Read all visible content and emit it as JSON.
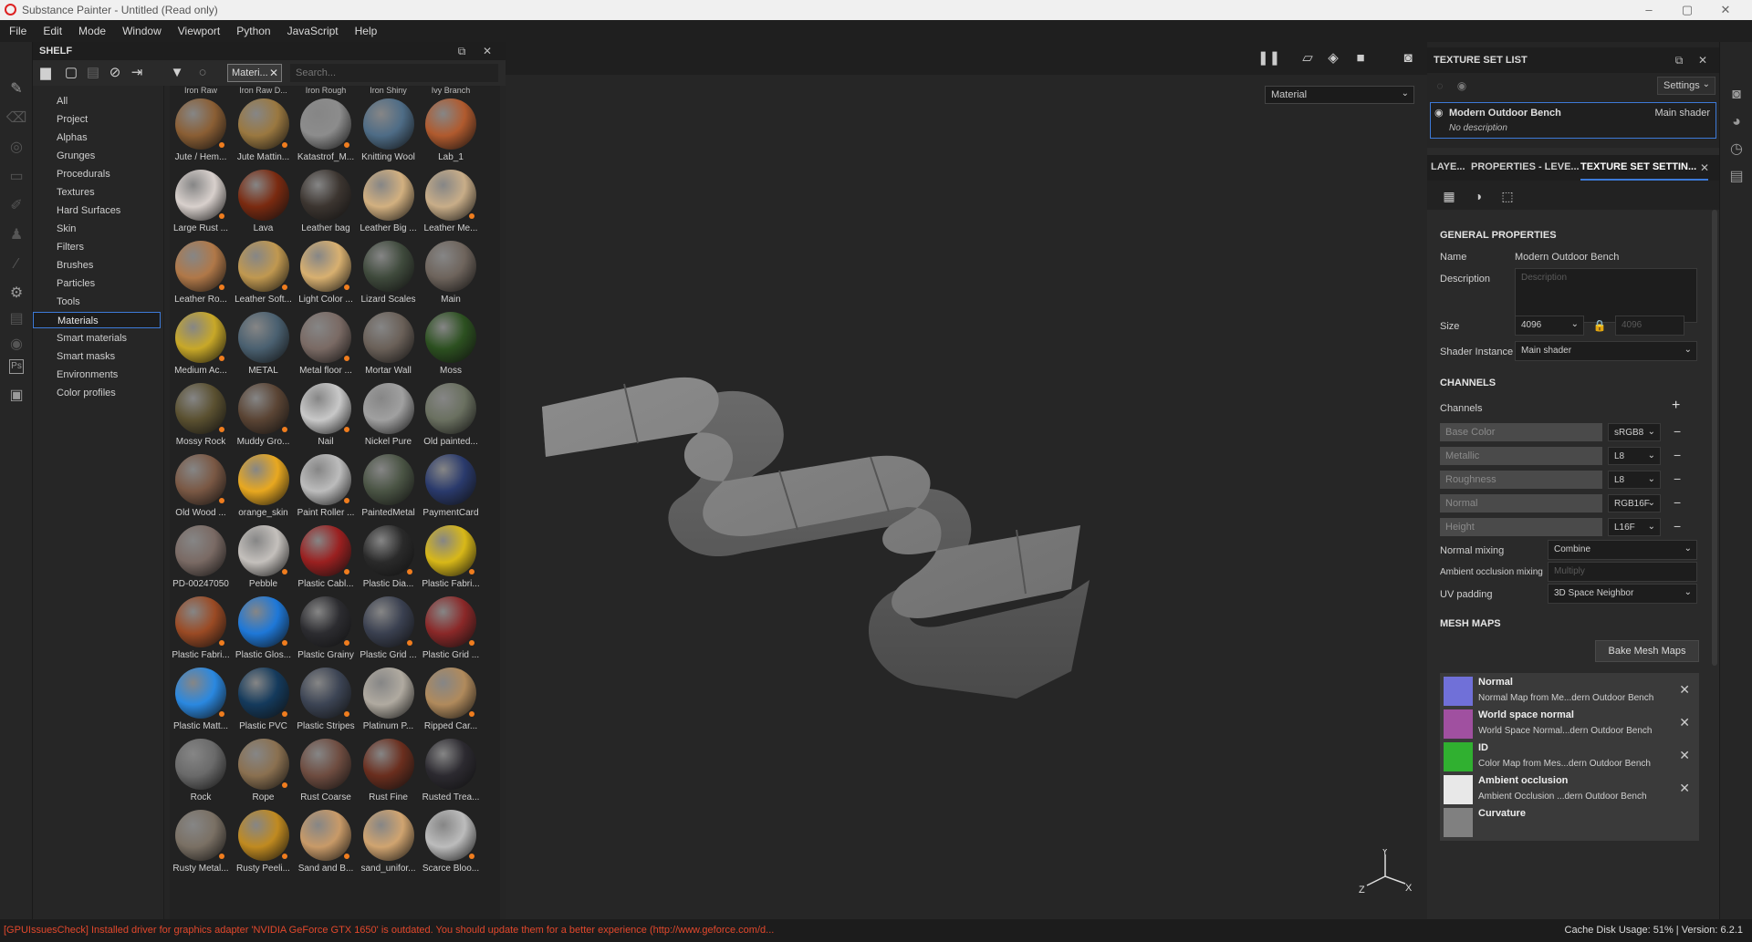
{
  "window": {
    "title": "Substance Painter - Untitled (Read only)",
    "controls": [
      "–",
      "▢",
      "✕"
    ]
  },
  "menu": [
    "File",
    "Edit",
    "Mode",
    "Window",
    "Viewport",
    "Python",
    "JavaScript",
    "Help"
  ],
  "shelf": {
    "title": "SHELF",
    "filter_chip": "Materi...",
    "search_placeholder": "Search...",
    "categories": [
      "All",
      "Project",
      "Alphas",
      "Grunges",
      "Procedurals",
      "Textures",
      "Hard Surfaces",
      "Skin",
      "Filters",
      "Brushes",
      "Particles",
      "Tools",
      "Materials",
      "Smart materials",
      "Smart masks",
      "Environments",
      "Color profiles"
    ],
    "selected_category": "Materials",
    "top_row_labels": [
      "Iron Raw",
      "Iron Raw D...",
      "Iron Rough",
      "Iron Shiny",
      "Ivy Branch"
    ],
    "materials": [
      {
        "name": "Jute / Hem...",
        "color": "#8a5e34",
        "new": true
      },
      {
        "name": "Jute Mattin...",
        "color": "#9a7840",
        "new": true
      },
      {
        "name": "Katastrof_M...",
        "color": "#8c8c8c",
        "new": true
      },
      {
        "name": "Knitting Wool",
        "color": "#4e6c86",
        "new": false
      },
      {
        "name": "Lab_1",
        "color": "#b05a2e",
        "new": false
      },
      {
        "name": "Large Rust ...",
        "color": "#d8d0cc",
        "new": true
      },
      {
        "name": "Lava",
        "color": "#7a2a10",
        "new": false
      },
      {
        "name": "Leather bag",
        "color": "#3c3530",
        "new": false
      },
      {
        "name": "Leather Big ...",
        "color": "#d2b080",
        "new": false
      },
      {
        "name": "Leather Me...",
        "color": "#c8ad88",
        "new": true
      },
      {
        "name": "Leather Ro...",
        "color": "#b07848",
        "new": true
      },
      {
        "name": "Leather Soft...",
        "color": "#c09850",
        "new": true
      },
      {
        "name": "Light Color ...",
        "color": "#d8b070",
        "new": true
      },
      {
        "name": "Lizard Scales",
        "color": "#3f4a3c",
        "new": false
      },
      {
        "name": "Main",
        "color": "#6e645c",
        "new": false
      },
      {
        "name": "Medium Ac...",
        "color": "#c8a828",
        "new": true
      },
      {
        "name": "METAL",
        "color": "#4a6070",
        "new": false
      },
      {
        "name": "Metal floor ...",
        "color": "#7a6a64",
        "new": true
      },
      {
        "name": "Mortar Wall",
        "color": "#6a6058",
        "new": false
      },
      {
        "name": "Moss",
        "color": "#2c5020",
        "new": false
      },
      {
        "name": "Mossy Rock",
        "color": "#5a5030",
        "new": true
      },
      {
        "name": "Muddy Gro...",
        "color": "#5a4434",
        "new": true
      },
      {
        "name": "Nail",
        "color": "#c8c8c8",
        "new": true
      },
      {
        "name": "Nickel Pure",
        "color": "#a0a0a0",
        "new": false
      },
      {
        "name": "Old painted...",
        "color": "#6a7060",
        "new": false
      },
      {
        "name": "Old Wood ...",
        "color": "#7a5844",
        "new": true
      },
      {
        "name": "orange_skin",
        "color": "#e8a820",
        "new": false
      },
      {
        "name": "Paint Roller ...",
        "color": "#bcbcbc",
        "new": true
      },
      {
        "name": "PaintedMetal",
        "color": "#4a5444",
        "new": false
      },
      {
        "name": "PaymentCard",
        "color": "#2a3a6c",
        "new": false
      },
      {
        "name": "PD-00247050",
        "color": "#7a6a64",
        "new": false
      },
      {
        "name": "Pebble",
        "color": "#c4c0bc",
        "new": true
      },
      {
        "name": "Plastic Cabl...",
        "color": "#9a2020",
        "new": true
      },
      {
        "name": "Plastic Dia...",
        "color": "#2a2a2a",
        "new": true
      },
      {
        "name": "Plastic Fabri...",
        "color": "#d8b818",
        "new": true
      },
      {
        "name": "Plastic Fabri...",
        "color": "#9a4a24",
        "new": true
      },
      {
        "name": "Plastic Glos...",
        "color": "#1e78d8",
        "new": true
      },
      {
        "name": "Plastic Grainy",
        "color": "#2c2c30",
        "new": true
      },
      {
        "name": "Plastic Grid ...",
        "color": "#3a4050",
        "new": true
      },
      {
        "name": "Plastic Grid ...",
        "color": "#8a2828",
        "new": true
      },
      {
        "name": "Plastic Matt...",
        "color": "#2a88e0",
        "new": true
      },
      {
        "name": "Plastic PVC",
        "color": "#143a5c",
        "new": true
      },
      {
        "name": "Plastic Stripes",
        "color": "#3c4454",
        "new": true
      },
      {
        "name": "Platinum P...",
        "color": "#b0aaa0",
        "new": false
      },
      {
        "name": "Ripped Car...",
        "color": "#b08a5c",
        "new": true
      },
      {
        "name": "Rock",
        "color": "#6a6a6a",
        "new": false
      },
      {
        "name": "Rope",
        "color": "#8a7050",
        "new": true
      },
      {
        "name": "Rust Coarse",
        "color": "#6e4c40",
        "new": false
      },
      {
        "name": "Rust Fine",
        "color": "#6a2e1e",
        "new": false
      },
      {
        "name": "Rusted Trea...",
        "color": "#2c2a30",
        "new": false
      },
      {
        "name": "Rusty Metal...",
        "color": "#7a7064",
        "new": true
      },
      {
        "name": "Rusty Peeli...",
        "color": "#c08a20",
        "new": true
      },
      {
        "name": "Sand and B...",
        "color": "#c89a68",
        "new": true
      },
      {
        "name": "sand_unifor...",
        "color": "#d0a470",
        "new": false
      },
      {
        "name": "Scarce Bloo...",
        "color": "#bcbcbc",
        "new": true
      }
    ]
  },
  "viewport": {
    "display_mode": "Material",
    "gizmo": {
      "x": "X",
      "y": "Y",
      "z": "Z"
    }
  },
  "texture_set_list": {
    "title": "TEXTURE SET LIST",
    "settings_label": "Settings",
    "row": {
      "name": "Modern Outdoor Bench",
      "shader": "Main shader",
      "description": "No description"
    }
  },
  "tabs": [
    "LAYE...",
    "PROPERTIES - LEVE...",
    "TEXTURE SET SETTIN..."
  ],
  "texture_set_settings": {
    "general_title": "GENERAL PROPERTIES",
    "name_label": "Name",
    "name_value": "Modern Outdoor Bench",
    "description_label": "Description",
    "description_placeholder": "Description",
    "size_label": "Size",
    "size_value": "4096",
    "size_value2": "4096",
    "shader_instance_label": "Shader Instance",
    "shader_instance_value": "Main shader",
    "channels_title": "CHANNELS",
    "channels_label": "Channels",
    "channels": [
      {
        "name": "Base Color",
        "format": "sRGB8"
      },
      {
        "name": "Metallic",
        "format": "L8"
      },
      {
        "name": "Roughness",
        "format": "L8"
      },
      {
        "name": "Normal",
        "format": "RGB16F"
      },
      {
        "name": "Height",
        "format": "L16F"
      }
    ],
    "normal_mixing_label": "Normal mixing",
    "normal_mixing_value": "Combine",
    "ao_mixing_label": "Ambient occlusion mixing",
    "ao_mixing_value": "Multiply",
    "uv_padding_label": "UV padding",
    "uv_padding_value": "3D Space Neighbor",
    "mesh_maps_title": "MESH MAPS",
    "bake_button": "Bake Mesh Maps",
    "mesh_maps": [
      {
        "title": "Normal",
        "sub": "Normal Map from Me...dern Outdoor Bench",
        "color": "#7070d8"
      },
      {
        "title": "World space normal",
        "sub": "World Space Normal...dern Outdoor Bench",
        "color": "#a050a0"
      },
      {
        "title": "ID",
        "sub": "Color Map from Mes...dern Outdoor Bench",
        "color": "#30b030"
      },
      {
        "title": "Ambient occlusion",
        "sub": "Ambient Occlusion ...dern Outdoor Bench",
        "color": "#e8e8e8"
      },
      {
        "title": "Curvature",
        "sub": "",
        "color": "#808080"
      }
    ]
  },
  "status": {
    "message": "[GPUIssuesCheck] Installed driver for graphics adapter 'NVIDIA GeForce GTX 1650' is outdated. You should update them for a better experience (http://www.geforce.com/d...",
    "right": "Cache Disk Usage:   51% | Version: 6.2.1"
  }
}
